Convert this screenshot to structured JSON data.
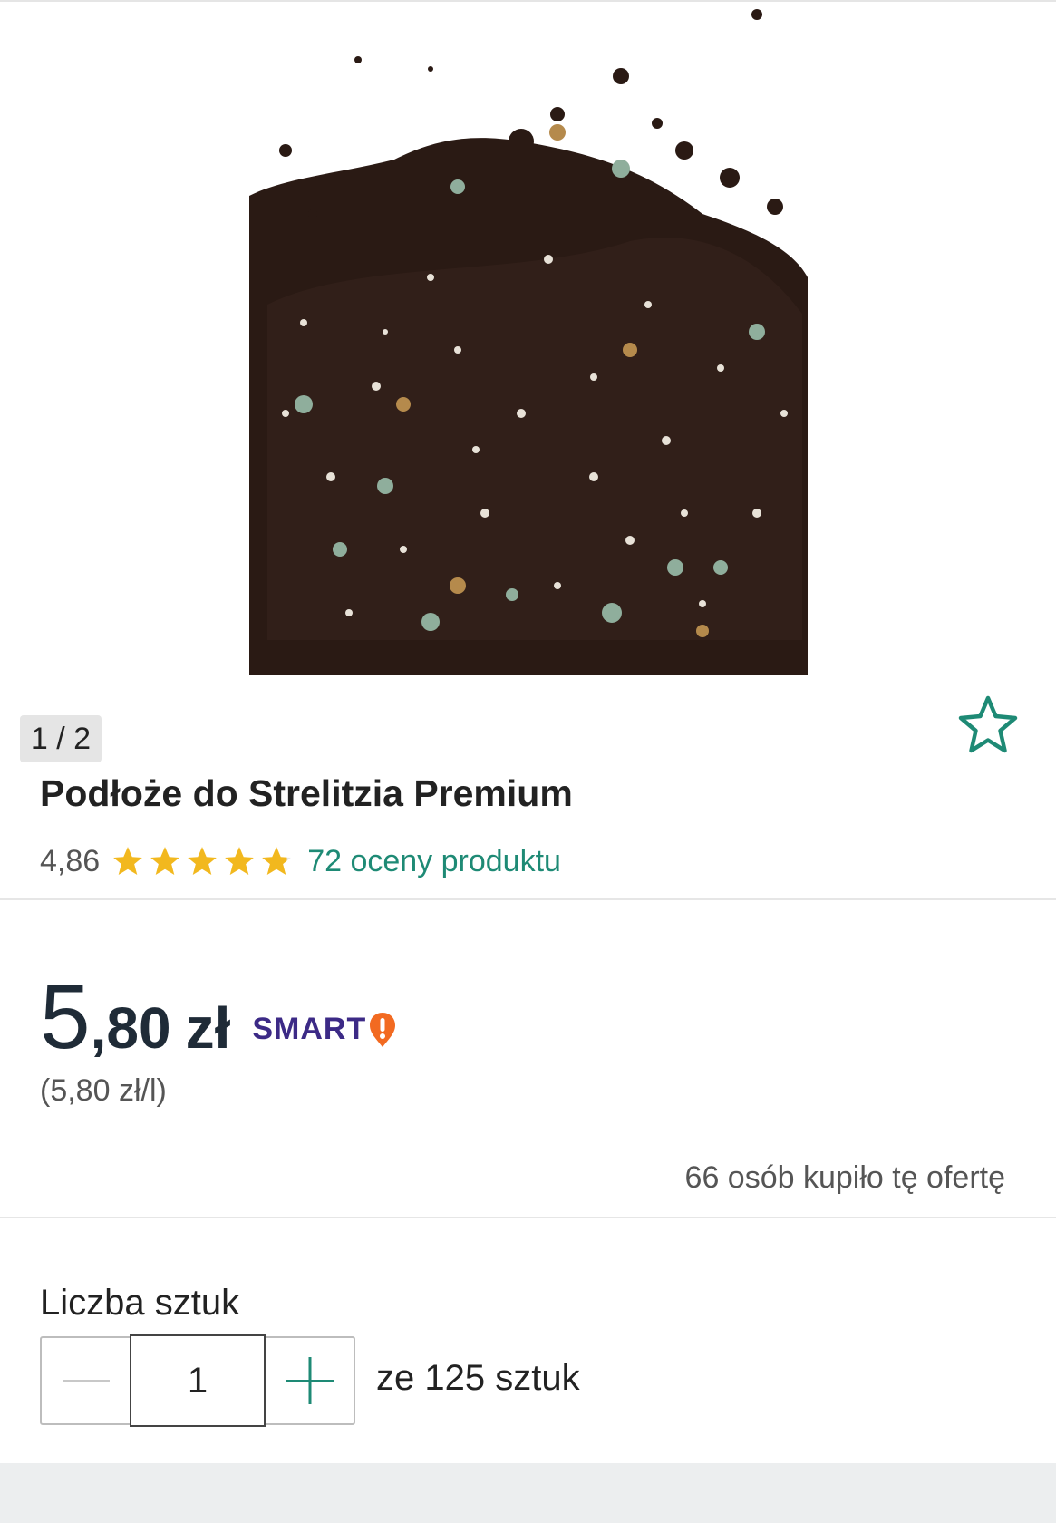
{
  "gallery": {
    "counter": "1 / 2",
    "image_alt": "product-photo"
  },
  "product": {
    "title": "Podłoże do Strelitzia Premium",
    "rating": {
      "value_text": "4,86",
      "stars": 4.86,
      "max_stars": 5,
      "reviews_text": "72 oceny produktu"
    }
  },
  "price": {
    "integer": "5",
    "decimal": ",80",
    "currency": "zł",
    "unit_price": "(5,80 zł/l)",
    "badge": "SMART"
  },
  "buyers_text": "66 osób kupiło tę ofertę",
  "quantity": {
    "label": "Liczba sztuk",
    "value": "1",
    "stock_text": "ze 125 sztuk"
  },
  "colors": {
    "accent": "#1e8a75",
    "star": "#f2b81e",
    "smart": "#3c2a86",
    "smart_icon": "#f26a21",
    "price": "#1f2b37"
  },
  "icons": {
    "favorite": "star-outline-icon",
    "minus": "minus-icon",
    "plus": "plus-icon"
  }
}
